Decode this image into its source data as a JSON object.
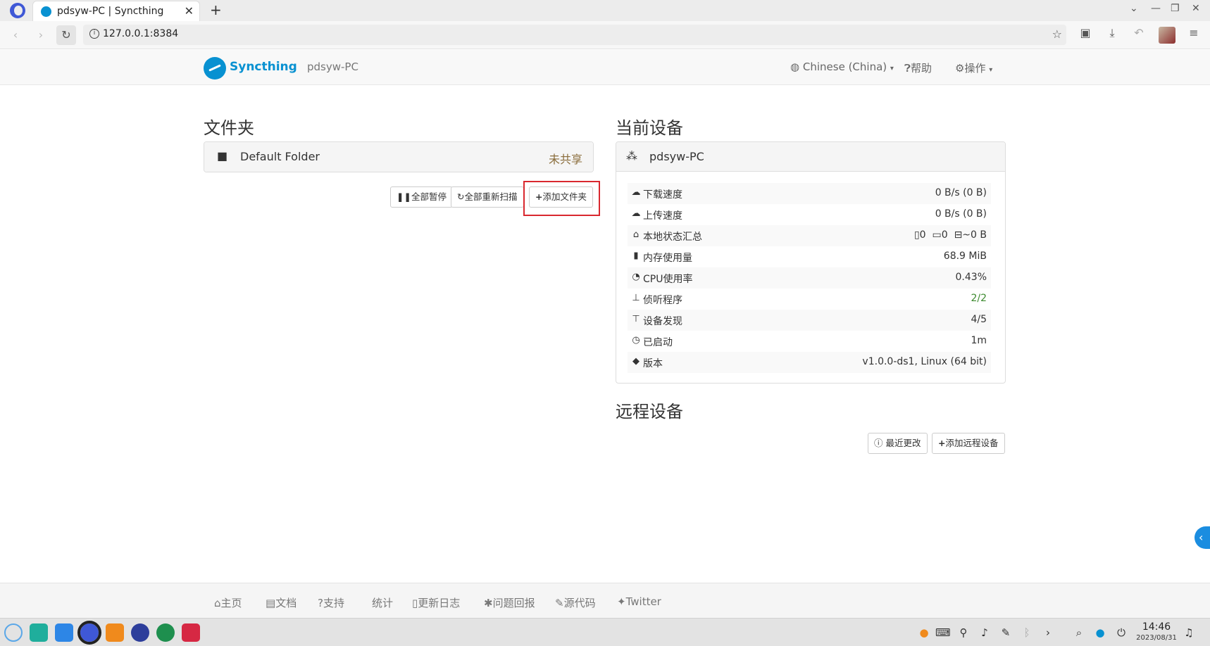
{
  "browser": {
    "tab_title": "pdsyw-PC | Syncthing",
    "tab_close": "✕",
    "new_tab": "+",
    "url": "127.0.0.1:8384"
  },
  "header": {
    "brand": "Syncthing",
    "device_name": "pdsyw-PC",
    "language": "Chinese (China)",
    "help": "帮助",
    "actions": "操作"
  },
  "folders": {
    "title": "文件夹",
    "items": [
      {
        "name": "Default Folder",
        "status": "未共享"
      }
    ],
    "buttons": {
      "pause_all": "全部暂停",
      "rescan_all": "全部重新扫描",
      "add_folder": "添加文件夹"
    }
  },
  "this_device": {
    "title": "当前设备",
    "name": "pdsyw-PC",
    "rows": [
      {
        "icon": "cloud-download-icon",
        "label": "下载速度",
        "value": "0 B/s (0 B)"
      },
      {
        "icon": "cloud-upload-icon",
        "label": "上传速度",
        "value": "0 B/s (0 B)"
      },
      {
        "icon": "home-icon",
        "label": "本地状态汇总",
        "files": "0",
        "dirs": "0",
        "size": "~0 B"
      },
      {
        "icon": "memory-icon",
        "label": "内存使用量",
        "value": "68.9 MiB"
      },
      {
        "icon": "dashboard-icon",
        "label": "CPU使用率",
        "value": "0.43%"
      },
      {
        "icon": "sitemap-icon",
        "label": "侦听程序",
        "value": "2/2"
      },
      {
        "icon": "signpost-icon",
        "label": "设备发现",
        "value": "4/5"
      },
      {
        "icon": "clock-icon",
        "label": "已启动",
        "value": "1m"
      },
      {
        "icon": "tag-icon",
        "label": "版本",
        "value": "v1.0.0-ds1, Linux (64 bit)"
      }
    ]
  },
  "remote_devices": {
    "title": "远程设备",
    "buttons": {
      "recent_changes": "最近更改",
      "add_remote": "添加远程设备"
    }
  },
  "footer": {
    "links": [
      "主页",
      "文档",
      "支持",
      "统计",
      "更新日志",
      "问题回报",
      "源代码",
      "Twitter"
    ]
  },
  "taskbar": {
    "time": "14:46",
    "date": "2023/08/31"
  },
  "colors": {
    "brand": "#0891d1",
    "unshared": "#8a6d3b",
    "listener_ok": "#3c8a2e",
    "highlight": "#d9282f"
  }
}
